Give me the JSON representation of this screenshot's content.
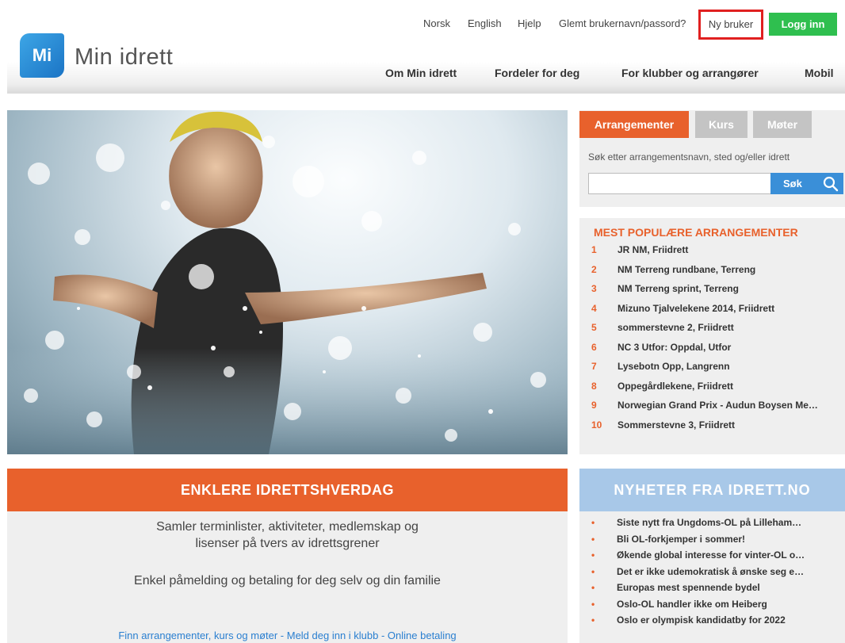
{
  "header": {
    "logo_mark": "Mi",
    "logo_text": "Min idrett",
    "utility_links": [
      "Norsk",
      "English",
      "Hjelp",
      "Glemt brukernavn/passord?"
    ],
    "ny_bruker": "Ny bruker",
    "logg_inn": "Logg inn",
    "nav": [
      "Om Min idrett",
      "Fordeler for deg",
      "For klubber og arrangører",
      "Mobil"
    ]
  },
  "search": {
    "tabs": [
      "Arrangementer",
      "Kurs",
      "Møter"
    ],
    "active_tab": "Arrangementer",
    "label": "Søk etter arrangementsnavn, sted og/eller idrett",
    "value": "",
    "button": "Søk"
  },
  "popular": {
    "title": "MEST POPULÆRE ARRANGEMENTER",
    "items": [
      {
        "num": "1",
        "label": "JR NM, Friidrett"
      },
      {
        "num": "2",
        "label": "NM Terreng rundbane, Terreng"
      },
      {
        "num": "3",
        "label": "NM Terreng sprint, Terreng"
      },
      {
        "num": "4",
        "label": "Mizuno Tjalvelekene 2014, Friidrett"
      },
      {
        "num": "5",
        "label": "sommerstevne 2, Friidrett"
      },
      {
        "num": "6",
        "label": "NC 3 Utfor: Oppdal, Utfor"
      },
      {
        "num": "7",
        "label": "Lysebotn Opp, Langrenn"
      },
      {
        "num": "8",
        "label": "Oppegårdlekene, Friidrett"
      },
      {
        "num": "9",
        "label": "Norwegian Grand Prix - Audun Boysen Me…"
      },
      {
        "num": "10",
        "label": "Sommerstevne 3, Friidrett"
      }
    ]
  },
  "enklere": {
    "title": "ENKLERE IDRETTSHVERDAG",
    "line1": "Samler terminlister, aktiviteter, medlemskap og",
    "line2": "lisenser på tvers av idrettsgrener",
    "line3": "Enkel påmelding og betaling for deg selv og din familie",
    "link": "Finn arrangementer, kurs og møter - Meld deg inn i klubb - Online betaling"
  },
  "nyheter": {
    "title": "NYHETER FRA IDRETT.NO",
    "items": [
      "Siste nytt fra Ungdoms-OL på Lilleham…",
      "Bli OL-forkjemper i sommer!",
      "Økende global interesse for vinter-OL o…",
      "Det er ikke udemokratisk å ønske seg e…",
      "Europas mest spennende bydel",
      "Oslo-OL handler ikke om Heiberg",
      "Oslo er olympisk kandidatby for 2022"
    ]
  },
  "colors": {
    "orange": "#e8612c",
    "green": "#2fbf4f",
    "blue": "#3a8fd8",
    "light_blue": "#a8c8e8",
    "red_outline": "#e02020"
  }
}
